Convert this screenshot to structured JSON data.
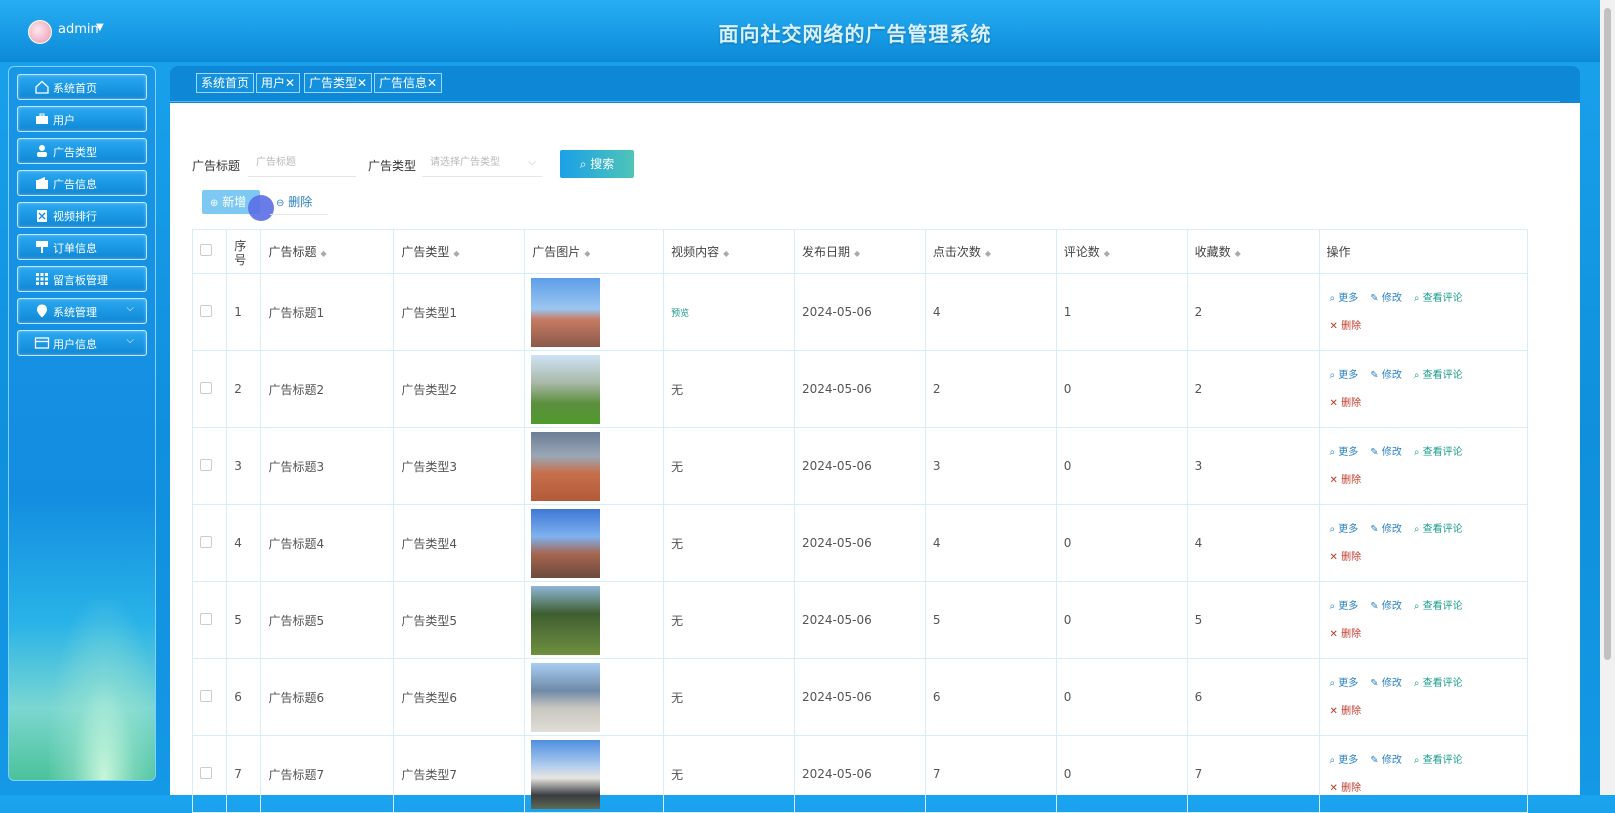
{
  "header": {
    "user": "admin",
    "title": "面向社交网络的广告管理系统"
  },
  "sidebar": {
    "items": [
      {
        "label": "系统首页",
        "icon": "home-icon"
      },
      {
        "label": "用户",
        "icon": "briefcase-icon"
      },
      {
        "label": "广告类型",
        "icon": "user-icon"
      },
      {
        "label": "广告信息",
        "icon": "wallet-icon"
      },
      {
        "label": "视频排行",
        "icon": "clipboard-icon"
      },
      {
        "label": "订单信息",
        "icon": "sign-icon"
      },
      {
        "label": "留言板管理",
        "icon": "grid-icon"
      },
      {
        "label": "系统管理",
        "icon": "location-icon",
        "expandable": true
      },
      {
        "label": "用户信息",
        "icon": "card-icon",
        "expandable": true
      }
    ]
  },
  "tabs": [
    {
      "label": "系统首页",
      "closable": false
    },
    {
      "label": "用户",
      "closable": true
    },
    {
      "label": "广告类型",
      "closable": true
    },
    {
      "label": "广告信息",
      "closable": true
    }
  ],
  "search": {
    "title_label": "广告标题",
    "title_placeholder": "广告标题",
    "type_label": "广告类型",
    "type_placeholder": "请选择广告类型",
    "search_button": "搜索"
  },
  "toolbar": {
    "add_label": "新增",
    "delete_label": "删除"
  },
  "table": {
    "headers": {
      "index": "序号",
      "title": "广告标题",
      "type": "广告类型",
      "image": "广告图片",
      "video": "视频内容",
      "date": "发布日期",
      "clicks": "点击次数",
      "comments": "评论数",
      "favorites": "收藏数",
      "ops": "操作"
    },
    "actions": {
      "more": "更多",
      "edit": "修改",
      "view_comments": "查看评论",
      "delete": "删除"
    },
    "rows": [
      {
        "index": "1",
        "title": "广告标题1",
        "type": "广告类型1",
        "video": "预览",
        "date": "2024-05-06",
        "clicks": "4",
        "comments": "1",
        "favorites": "2"
      },
      {
        "index": "2",
        "title": "广告标题2",
        "type": "广告类型2",
        "video": "无",
        "date": "2024-05-06",
        "clicks": "2",
        "comments": "0",
        "favorites": "2"
      },
      {
        "index": "3",
        "title": "广告标题3",
        "type": "广告类型3",
        "video": "无",
        "date": "2024-05-06",
        "clicks": "3",
        "comments": "0",
        "favorites": "3"
      },
      {
        "index": "4",
        "title": "广告标题4",
        "type": "广告类型4",
        "video": "无",
        "date": "2024-05-06",
        "clicks": "4",
        "comments": "0",
        "favorites": "4"
      },
      {
        "index": "5",
        "title": "广告标题5",
        "type": "广告类型5",
        "video": "无",
        "date": "2024-05-06",
        "clicks": "5",
        "comments": "0",
        "favorites": "5"
      },
      {
        "index": "6",
        "title": "广告标题6",
        "type": "广告类型6",
        "video": "无",
        "date": "2024-05-06",
        "clicks": "6",
        "comments": "0",
        "favorites": "6"
      },
      {
        "index": "7",
        "title": "广告标题7",
        "type": "广告类型7",
        "video": "无",
        "date": "2024-05-06",
        "clicks": "7",
        "comments": "0",
        "favorites": "7"
      }
    ]
  }
}
